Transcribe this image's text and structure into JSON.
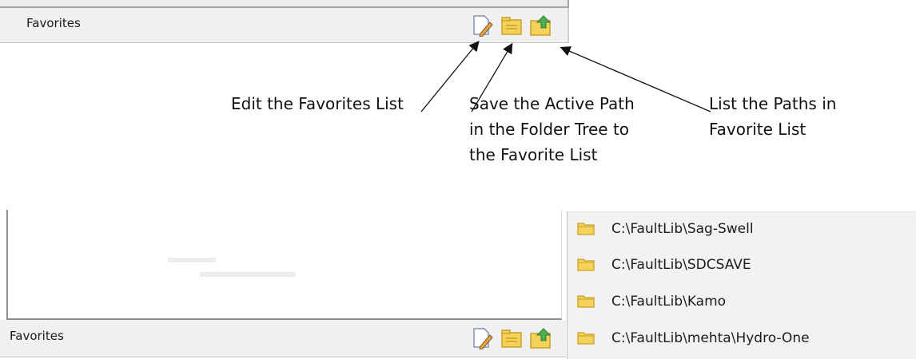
{
  "top_bar": {
    "label": "Favorites",
    "buttons": [
      {
        "name": "edit-favorites-button",
        "icon": "edit-pencil-icon"
      },
      {
        "name": "save-active-path-button",
        "icon": "folder-icon"
      },
      {
        "name": "list-paths-button",
        "icon": "folder-up-arrow-icon"
      }
    ]
  },
  "callouts": {
    "edit": "Edit the Favorites List",
    "save_lines": [
      "Save the Active Path",
      "in the Folder Tree to",
      "the Favorite List"
    ],
    "list_lines": [
      "List the Paths in",
      "Favorite List"
    ]
  },
  "bottom_bar": {
    "label": "Favorites"
  },
  "path_menu": {
    "items": [
      {
        "icon": "folder-icon",
        "path": "C:\\FaultLib\\Sag-Swell"
      },
      {
        "icon": "folder-icon",
        "path": "C:\\FaultLib\\SDCSAVE"
      },
      {
        "icon": "folder-icon",
        "path": "C:\\FaultLib\\Kamo"
      },
      {
        "icon": "folder-icon",
        "path": "C:\\FaultLib\\mehta\\Hydro-One"
      }
    ]
  },
  "colors": {
    "bar_bg": "#f0f0f0",
    "folder_fill": "#f5d35a",
    "folder_edge": "#c9a227",
    "arrow_green": "#4caf50"
  }
}
